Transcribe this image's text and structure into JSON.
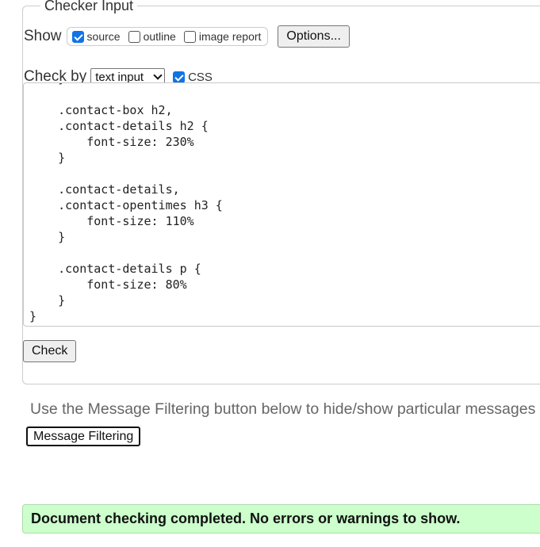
{
  "checker": {
    "legend": "Checker Input",
    "show_label": "Show",
    "show_options": [
      {
        "label": "source",
        "checked": true
      },
      {
        "label": "outline",
        "checked": false
      },
      {
        "label": "image report",
        "checked": false
      }
    ],
    "options_button": "Options...",
    "check_by_label": "Check by",
    "check_by_value": "text input",
    "css_label": "CSS",
    "css_checked": true,
    "source_text": "    }\n\n    .contact-box h2,\n    .contact-details h2 {\n        font-size: 230%\n    }\n\n    .contact-details,\n    .contact-opentimes h3 {\n        font-size: 110%\n    }\n\n    .contact-details p {\n        font-size: 80%\n    }\n}",
    "check_button": "Check"
  },
  "filtering": {
    "hint": "Use the Message Filtering button below to hide/show particular messages",
    "button": "Message Filtering"
  },
  "result": {
    "message": "Document checking completed. No errors or warnings to show."
  },
  "colors": {
    "checkbox_accent": "#0f74e5",
    "success_bg": "#ccffcc"
  }
}
